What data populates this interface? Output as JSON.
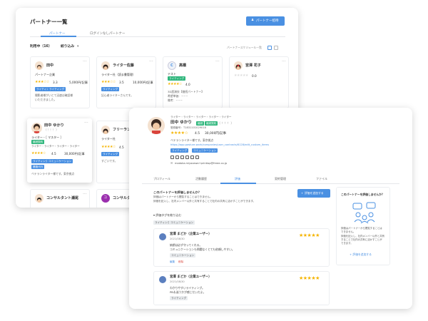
{
  "back": {
    "title": "パートナー一覧",
    "register_button": "パートナー招待",
    "tabs": [
      "パートナー",
      "ログインなしパートナー"
    ],
    "filter": "利用中（16）",
    "filter_more": "絞り込み",
    "view_label": "パートナースケジュール一覧",
    "cards": [
      {
        "name": "田中",
        "role": "パートナー企業",
        "rating": "3.3",
        "price": "5,000円/記事",
        "tags": [
          "ライティング",
          "ライティング"
        ],
        "text": "撮影者様がいとて迅速は確認様",
        "text2": "いただきました。"
      },
      {
        "name": "ライター佐藤",
        "role": "ライター社（読ま書管理）",
        "rating": "3.5",
        "price": "10,000円/記事",
        "tags": [
          "ライティング"
        ],
        "text": "記心者ライターさんです。"
      },
      {
        "name": "高橋",
        "role": "テスト",
        "badge": "ライティング",
        "rating": "4.0",
        "text": "3D超演技【継続パートナー】",
        "text2": "希望単価：~~~",
        "text3": "備考：~~~"
      },
      {
        "name": "宮澤 花子",
        "rating": "0.0"
      }
    ],
    "selected": {
      "name": "田中 ゆかり",
      "kana": "（ ！！！ ）",
      "role": "ライター・［ マスター ］",
      "badge": "継続契約",
      "sub": "ライター・ライター・ライター・ライター",
      "rating": "4.5",
      "price": "30,000円/記事",
      "tags": [
        "ライティング",
        "コミュニケーション",
        "業務代行"
      ],
      "text": "ベテランライター様です。東京拠点"
    },
    "card_free": {
      "name": "フリーラン",
      "sub": "ライター社",
      "rating": "4.5",
      "tag": "ライティング",
      "text": "すごいです。"
    },
    "bottom": [
      {
        "name": "コンサルタント瀬尾"
      },
      {
        "name": "コンサルタ",
        "initial": "コ"
      }
    ]
  },
  "front": {
    "top_label": "ライター・ライター・ライター・ライター・ライター",
    "name": "田中 ゆかり",
    "badge1": "継続",
    "badge2": "継続契約",
    "kana": "（ ！！！ ）",
    "number": "登録番号：T1831101029018",
    "rating": "4.5",
    "price": "30,000円/記事",
    "intro": "ベテランライター様です。東京拠点",
    "url": "https://app.pasture.work/companies/user_contracts/6128/edit_custom_items",
    "tags": [
      "ライティング",
      "コミュニケーション"
    ],
    "email": "madoka.miyazawa+printiop@freee.co.jp",
    "tabs": [
      "プロフィール",
      "活動履歴",
      "評価",
      "契約管理",
      "ファイル"
    ],
    "active_tab": "評価",
    "eval_question": "このパートナーを評価しませんか？",
    "eval_desc1": "評価はパートナーから閲覧することはできません。",
    "eval_desc2": "評価を記入し、社内メンバー以外と共有することで社内の共有に活かすことができます。",
    "eval_button": "評価を追加する",
    "filter_label": "評価タグを絞り込む",
    "filter_tags": [
      "ライティング",
      "コミュニケーション"
    ],
    "reviews": [
      {
        "author": "宮澤 まどか（企業ユーザー）",
        "date": "2021/08/30",
        "line1": "納期は必ず守ってくれる。",
        "line2": "コミュニケーションも問題なくとても依頼しやすい。",
        "tag": "コミュニケーション",
        "edit": "編集",
        "delete": "削除"
      },
      {
        "author": "宮澤 まどか（企業ユーザー）",
        "date": "2021/08/30",
        "line1": "わかりやすいライティング。",
        "line2": "PB＆迷うかが感じだいだよ。",
        "tag": "ライティング"
      }
    ],
    "side_title": "このパートナーを評価しませんか？",
    "side_desc": [
      "評価はパートナーから閲覧することは",
      "できません。",
      "評価を記入し、社内メンバー以外と共有",
      "することで社内の共有に活かすことが",
      "できます。"
    ],
    "side_button": "評価を追加する"
  },
  "colors": {
    "accent": "#4a90e2",
    "green": "#2fb67c",
    "star": "#f5b400"
  }
}
